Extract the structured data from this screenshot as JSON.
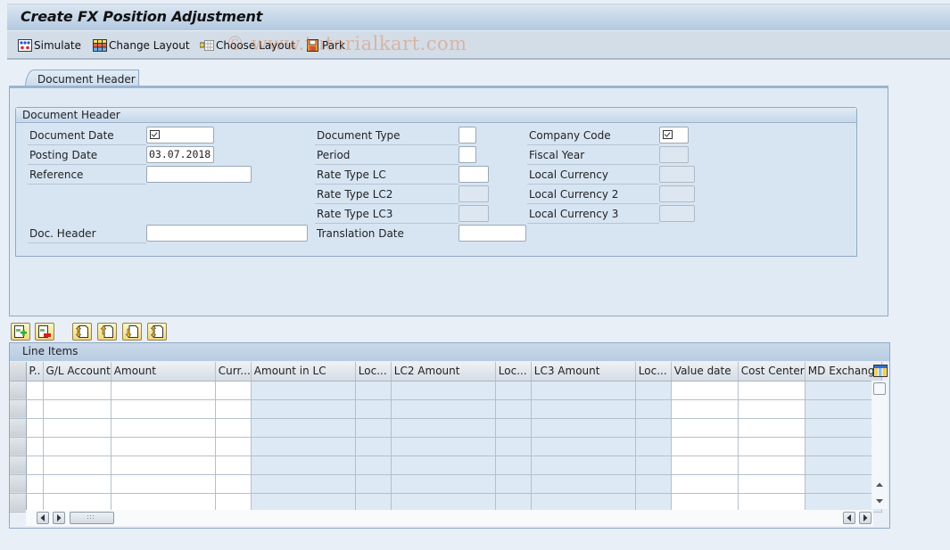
{
  "title": "Create FX Position Adjustment",
  "toolbar": {
    "simulate": "Simulate",
    "change_layout": "Change Layout",
    "choose_layout": "Choose Layout",
    "park": "Park",
    "watermark": "© www.tutorialkart.com"
  },
  "tab": {
    "label": "Document Header"
  },
  "group": {
    "title": "Document Header",
    "fields": {
      "document_date": {
        "label": "Document Date",
        "value": "",
        "required": true
      },
      "posting_date": {
        "label": "Posting Date",
        "value": "03.07.2018"
      },
      "reference": {
        "label": "Reference",
        "value": ""
      },
      "doc_header": {
        "label": "Doc. Header",
        "value": ""
      },
      "document_type": {
        "label": "Document Type",
        "value": ""
      },
      "period": {
        "label": "Period",
        "value": ""
      },
      "rate_type_lc": {
        "label": "Rate Type LC",
        "value": ""
      },
      "rate_type_lc2": {
        "label": "Rate Type LC2",
        "value": ""
      },
      "rate_type_lc3": {
        "label": "Rate Type LC3",
        "value": ""
      },
      "translation_date": {
        "label": "Translation Date",
        "value": ""
      },
      "company_code": {
        "label": "Company Code",
        "value": "",
        "required": true
      },
      "fiscal_year": {
        "label": "Fiscal Year",
        "value": ""
      },
      "local_currency": {
        "label": "Local Currency",
        "value": ""
      },
      "local_currency_2": {
        "label": "Local Currency 2",
        "value": ""
      },
      "local_currency_3": {
        "label": "Local Currency 3",
        "value": ""
      }
    }
  },
  "line_items": {
    "title": "Line Items",
    "toolbar_icons": [
      "insert-row-icon",
      "delete-row-icon",
      "first-page-icon",
      "previous-page-icon",
      "next-page-icon",
      "last-page-icon"
    ],
    "columns": [
      "P..",
      "G/L Account",
      "Amount",
      "Curr...",
      "Amount in LC",
      "Loc...",
      "LC2 Amount",
      "Loc...",
      "LC3 Amount",
      "Loc...",
      "Value date",
      "Cost Center",
      "MD Exchange"
    ],
    "rows": [
      [
        "",
        "",
        "",
        "",
        "",
        "",
        "",
        "",
        "",
        "",
        "",
        "",
        ""
      ],
      [
        "",
        "",
        "",
        "",
        "",
        "",
        "",
        "",
        "",
        "",
        "",
        "",
        ""
      ],
      [
        "",
        "",
        "",
        "",
        "",
        "",
        "",
        "",
        "",
        "",
        "",
        "",
        ""
      ],
      [
        "",
        "",
        "",
        "",
        "",
        "",
        "",
        "",
        "",
        "",
        "",
        "",
        ""
      ],
      [
        "",
        "",
        "",
        "",
        "",
        "",
        "",
        "",
        "",
        "",
        "",
        "",
        ""
      ],
      [
        "",
        "",
        "",
        "",
        "",
        "",
        "",
        "",
        "",
        "",
        "",
        "",
        ""
      ],
      [
        "",
        "",
        "",
        "",
        "",
        "",
        "",
        "",
        "",
        "",
        "",
        "",
        ""
      ]
    ]
  }
}
